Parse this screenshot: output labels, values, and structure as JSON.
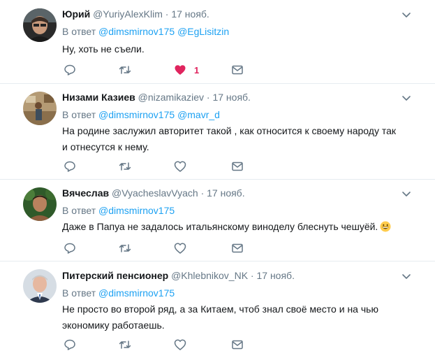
{
  "tweets": [
    {
      "name": "Юрий",
      "handle": "@YuriyAlexKlim",
      "dot": "·",
      "date": "17 нояб.",
      "reply_prefix": "В ответ",
      "reply_to": [
        "@dimsmirnov175",
        "@EgLisitzin"
      ],
      "text": "Ну, хоть не съели.",
      "like_count": "1",
      "liked": true
    },
    {
      "name": "Низами Казиев",
      "handle": "@nizamikaziev",
      "dot": "·",
      "date": "17 нояб.",
      "reply_prefix": "В ответ",
      "reply_to": [
        "@dimsmirnov175",
        "@mavr_d"
      ],
      "text": "На родине заслужил авторитет такой , как относится к своему народу так и отнесутся к нему."
    },
    {
      "name": "Вячеслав",
      "handle": "@VyacheslavVyach",
      "dot": "·",
      "date": "17 нояб.",
      "reply_prefix": "В ответ",
      "reply_to": [
        "@dimsmirnov175"
      ],
      "text": "Даже в Папуа не задалось итальянскому виноделу блеснуть чешуёй."
    },
    {
      "name": "Питерский пенсионер",
      "handle": "@Khlebnikov_NK",
      "dot": "·",
      "date": "17 нояб.",
      "reply_prefix": "В ответ",
      "reply_to": [
        "@dimsmirnov175"
      ],
      "text": "Не просто во второй ряд, а за Китаем, чтоб знал своё место и на чью экономику работаешь."
    }
  ],
  "icons": {
    "reply": "reply-icon",
    "retweet": "retweet-icon",
    "like": "heart-icon",
    "message": "envelope-icon",
    "caret": "chevron-down-icon",
    "emoji": "grinning-face-emoji-icon"
  },
  "colors": {
    "link": "#1da1f2",
    "muted": "#657786",
    "like_active": "#e0245e",
    "divider": "#e6ecf0"
  }
}
